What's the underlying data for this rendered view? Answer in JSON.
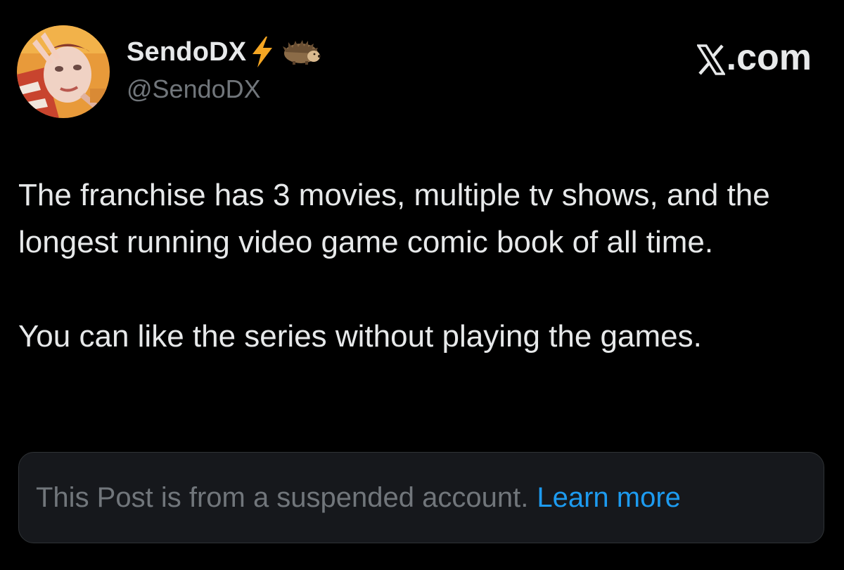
{
  "author": {
    "display_name": "SendoDX",
    "handle": "@SendoDX",
    "badges": [
      "bolt-icon",
      "hedgehog-icon"
    ]
  },
  "brand": {
    "icon": "x-logo-icon",
    "suffix": ".com"
  },
  "post": {
    "paragraphs": [
      "The franchise has 3 movies, multiple tv shows, and the longest running video game comic book of all time.",
      "You can like the series without playing the games."
    ]
  },
  "notice": {
    "text": "This Post is from a suspended account.",
    "link_label": "Learn more"
  },
  "colors": {
    "background": "#000000",
    "primary_text": "#e7e9ea",
    "secondary_text": "#71767b",
    "link": "#1d9bf0",
    "notice_background": "#16181c",
    "bolt": "#f5a623"
  }
}
